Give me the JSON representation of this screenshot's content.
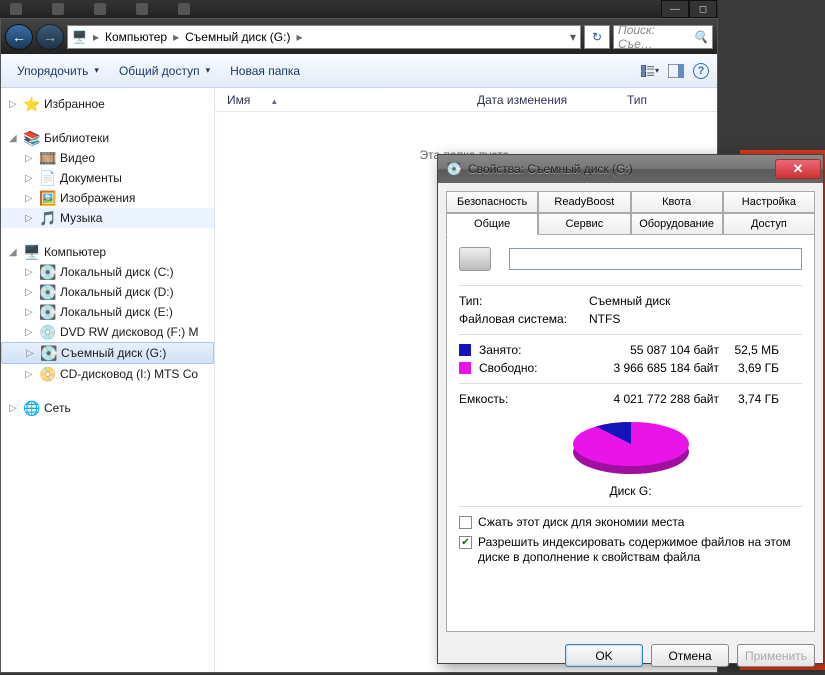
{
  "address": {
    "root": "Компьютер",
    "segment": "Съемный диск (G:)"
  },
  "search": {
    "placeholder": "Поиск: Съе…"
  },
  "toolbar": {
    "organize": "Упорядочить",
    "share": "Общий доступ",
    "new_folder": "Новая папка"
  },
  "columns": {
    "name": "Имя",
    "date": "Дата изменения",
    "type": "Тип"
  },
  "empty_message": "Эта папка пуста.",
  "sidebar": {
    "favorites": "Избранное",
    "libraries": "Библиотеки",
    "video": "Видео",
    "documents": "Документы",
    "images": "Изображения",
    "music": "Музыка",
    "computer": "Компьютер",
    "local_c": "Локальный диск (C:)",
    "local_d": "Локальный диск (D:)",
    "local_e": "Локальный диск (E:)",
    "dvd_f": "DVD RW дисковод (F:) M",
    "removable_g": "Съемный диск (G:)",
    "cd_i": "CD-дисковод (I:) MTS Co",
    "network": "Сеть"
  },
  "dialog": {
    "title": "Свойства: Съемный диск (G:)",
    "tabs_top": [
      "Безопасность",
      "ReadyBoost",
      "Квота",
      "Настройка"
    ],
    "tabs_bottom": [
      "Общие",
      "Сервис",
      "Оборудование",
      "Доступ"
    ],
    "type_label": "Тип:",
    "type_value": "Съемный диск",
    "fs_label": "Файловая система:",
    "fs_value": "NTFS",
    "used_label": "Занято:",
    "used_bytes": "55 087 104 байт",
    "used_hr": "52,5 МБ",
    "free_label": "Свободно:",
    "free_bytes": "3 966 685 184 байт",
    "free_hr": "3,69 ГБ",
    "cap_label": "Емкость:",
    "cap_bytes": "4 021 772 288 байт",
    "cap_hr": "3,74 ГБ",
    "pie_label": "Диск G:",
    "compress_label": "Сжать этот диск для экономии места",
    "index_label": "Разрешить индексировать содержимое файлов на этом диске в дополнение к свойствам файла",
    "ok": "OK",
    "cancel": "Отмена",
    "apply": "Применить"
  },
  "chart_data": {
    "type": "pie",
    "title": "Диск G:",
    "series": [
      {
        "name": "Занято",
        "value": 55087104,
        "value_hr": "52,5 МБ",
        "color": "#1414b8"
      },
      {
        "name": "Свободно",
        "value": 3966685184,
        "value_hr": "3,69 ГБ",
        "color": "#e814e8"
      }
    ],
    "total": 4021772288,
    "total_hr": "3,74 ГБ"
  }
}
